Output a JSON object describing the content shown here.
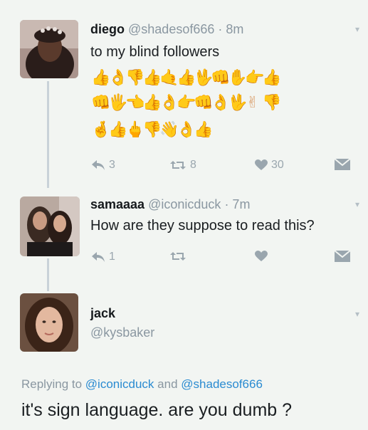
{
  "tweets": [
    {
      "name": "diego",
      "handle": "@shadesof666",
      "time": "· 8m",
      "text": "to my blind followers",
      "emoji_rows": [
        [
          "👍",
          "👌",
          "👎",
          "👍",
          "🤙",
          "👍",
          "🖖",
          "👊",
          "✋",
          "👉",
          "👍"
        ],
        [
          "👊",
          "🖐",
          "👈",
          "👍",
          "👌",
          "👉",
          "👊",
          "👌",
          "🖖",
          "✌",
          "👎"
        ],
        [
          "🤞",
          "👍",
          "🖕",
          "👎",
          "👋",
          "👌",
          "👍"
        ]
      ],
      "replies": "3",
      "retweets": "8",
      "likes": "30"
    },
    {
      "name": "samaaaa",
      "handle": "@iconicduck",
      "time": "· 7m",
      "text": "How are they suppose to read this?",
      "replies": "1",
      "retweets": "",
      "likes": ""
    },
    {
      "name": "jack",
      "handle": "@kysbaker"
    }
  ],
  "reply_context": {
    "prefix": "Replying to",
    "mention1": "@iconicduck",
    "joiner": "and",
    "mention2": "@shadesof666"
  },
  "final_text": "it's sign language. are you dumb ?",
  "icons": {
    "reply": "reply-icon",
    "retweet": "retweet-icon",
    "like": "heart-icon",
    "dm": "envelope-icon",
    "more": "chevron-down-icon"
  },
  "colors": {
    "background": "#f2f5f2",
    "muted": "#8a97a1",
    "link": "#2a8bd1",
    "icon": "#9aa6ae",
    "skin_tone": "#d6a173"
  }
}
